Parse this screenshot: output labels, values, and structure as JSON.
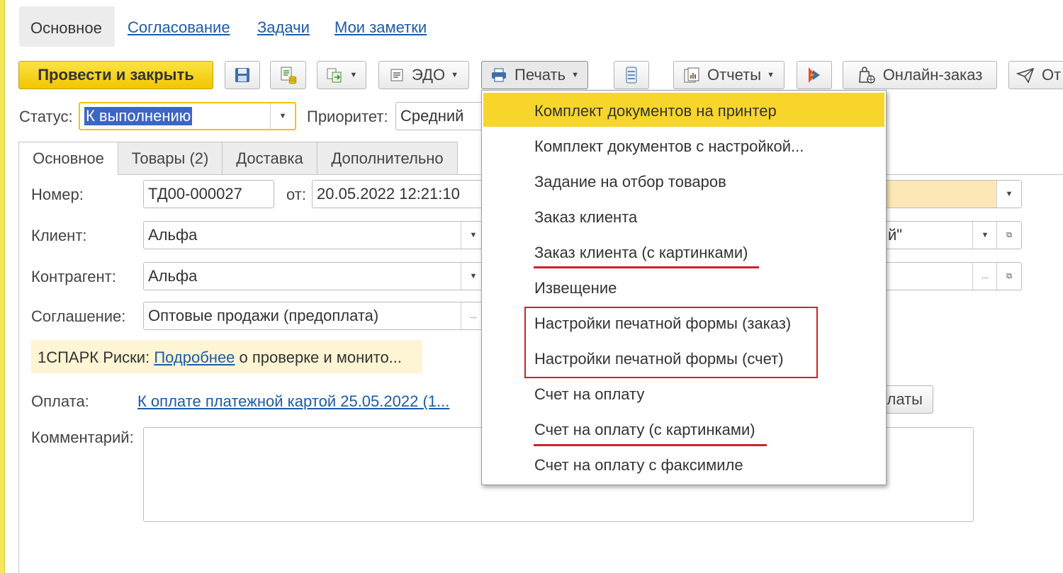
{
  "nav": {
    "tabs": [
      {
        "label": "Основное"
      },
      {
        "label": "Согласование"
      },
      {
        "label": "Задачи"
      },
      {
        "label": "Мои заметки"
      }
    ]
  },
  "toolbar": {
    "post_close": "Провести и закрыть",
    "edo": "ЭДО",
    "print": "Печать",
    "reports": "Отчеты",
    "online_order": "Онлайн-заказ",
    "truncated": "От"
  },
  "status_row": {
    "status_label": "Статус:",
    "status_value": "К выполнению",
    "priority_label": "Приоритет:",
    "priority_value": "Средний"
  },
  "form_tabs": [
    "Основное",
    "Товары (2)",
    "Доставка",
    "Дополнительно"
  ],
  "form": {
    "number_label": "Номер:",
    "number_value": "ТД00-000027",
    "date_label": "от:",
    "date_value": "20.05.2022 12:21:10",
    "client_label": "Клиент:",
    "client_value": "Альфа",
    "partner_label": "Контрагент:",
    "partner_value": "Альфа",
    "agreement_label": "Соглашение:",
    "agreement_value": "Оптовые продажи (предоплата)",
    "right_field2_value": "й\"",
    "spark_prefix": "1СПАРК Риски:",
    "spark_link": "Подробнее",
    "spark_suffix": "о проверке и монито...",
    "payment_label": "Оплата:",
    "payment_link": "К оплате платежной картой 25.05.2022 (1...",
    "payment_button_tail": "латы",
    "comment_label": "Комментарий:"
  },
  "print_menu": {
    "items": [
      "Комплект документов на принтер",
      "Комплект документов с настройкой...",
      "Задание на отбор товаров",
      "Заказ клиента",
      "Заказ клиента (с картинками)",
      "Извещение",
      "Настройки печатной формы (заказ)",
      "Настройки печатной формы (счет)",
      "Счет на оплату",
      "Счет на оплату (с картинками)",
      "Счет на оплату с факсимиле"
    ],
    "highlighted_index": 0
  },
  "colors": {
    "accent_yellow": "#f8d52a",
    "link_blue": "#1d5ba8",
    "annotation_red": "#d0222a"
  }
}
